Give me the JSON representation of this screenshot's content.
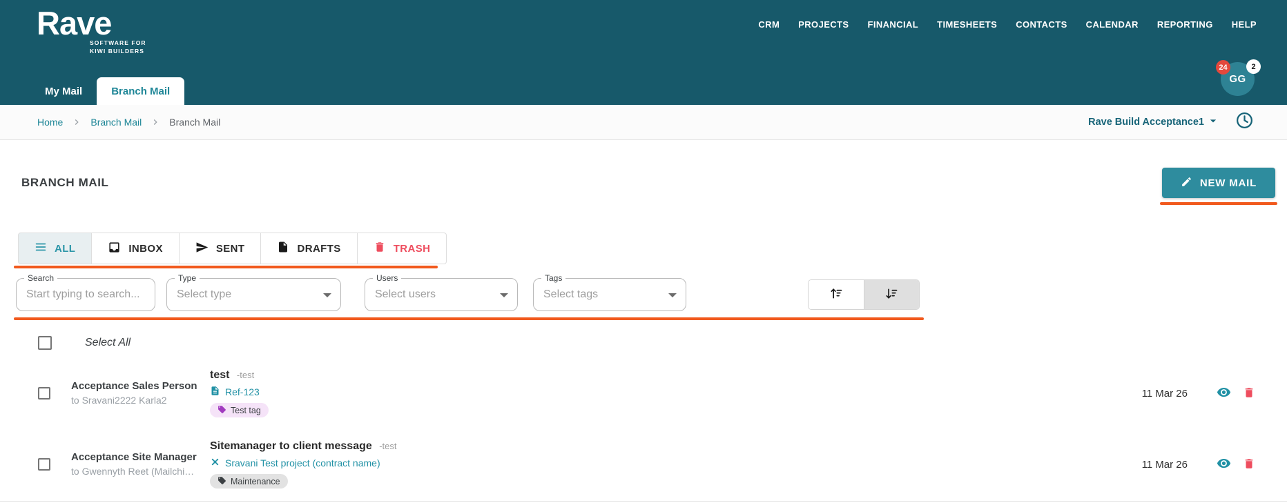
{
  "header": {
    "brand": {
      "name": "Rave",
      "tagline_line1": "SOFTWARE FOR",
      "tagline_line2": "KIWI BUILDERS"
    },
    "nav_items": [
      "CRM",
      "PROJECTS",
      "FINANCIAL",
      "TIMESHEETS",
      "CONTACTS",
      "CALENDAR",
      "REPORTING",
      "HELP"
    ],
    "user": {
      "initials": "GG",
      "notification_count": "24",
      "message_count": "2"
    },
    "mail_tabs": [
      {
        "label": "My Mail"
      },
      {
        "label": "Branch Mail"
      }
    ]
  },
  "breadcrumb": {
    "items": [
      "Home",
      "Branch Mail",
      "Branch Mail"
    ]
  },
  "toolbar": {
    "workspace_name": "Rave Build Acceptance1"
  },
  "page": {
    "title": "BRANCH MAIL",
    "new_mail_button": "NEW MAIL"
  },
  "folder_tabs": {
    "all": "ALL",
    "inbox": "INBOX",
    "sent": "SENT",
    "drafts": "DRAFTS",
    "trash": "TRASH"
  },
  "filters": {
    "search_label": "Search",
    "search_placeholder": "Start typing to search...",
    "type_label": "Type",
    "type_placeholder": "Select type",
    "users_label": "Users",
    "users_placeholder": "Select users",
    "tags_label": "Tags",
    "tags_placeholder": "Select tags"
  },
  "mail_list": {
    "select_all_label": "Select All",
    "rows": [
      {
        "sender": "Acceptance Sales Person",
        "recipient": "to Sravani2222 Karla2",
        "subject": "test",
        "subject_note": "-test",
        "link": "Ref-123",
        "link_icon": "document-icon",
        "tag": "Test tag",
        "date": "11 Mar 26"
      },
      {
        "sender": "Acceptance Site Manager",
        "recipient": "to Gwennyth Reet (Mailchi…",
        "subject": "Sitemanager to client message",
        "subject_note": "-test",
        "link": "Sravani Test project (contract name)",
        "link_icon": "tools-icon",
        "tag": "Maintenance",
        "date": "11 Mar 26"
      }
    ]
  },
  "colors": {
    "header_teal": "#17596A",
    "avatar_teal": "#2E8294",
    "accent_teal": "#1E8697",
    "button_teal": "#2E8C9E",
    "annotation_orange": "#F1591D",
    "trash_red": "#EE4D5E",
    "badge_red": "#E4483C",
    "tag_purple": "#A13BBF"
  }
}
